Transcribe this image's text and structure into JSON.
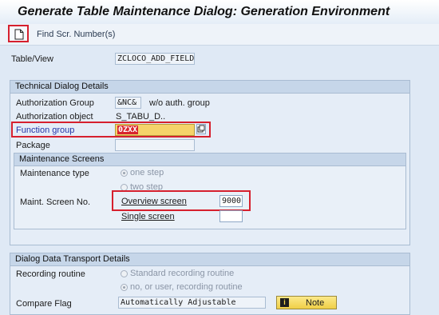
{
  "window": {
    "title": "Generate Table Maintenance Dialog: Generation Environment"
  },
  "toolbar": {
    "find_label": "Find Scr. Number(s)"
  },
  "table_view": {
    "label": "Table/View",
    "value": "ZCLOCO_ADD_FIELD"
  },
  "technical": {
    "header": "Technical Dialog Details",
    "auth_group_label": "Authorization Group",
    "auth_group_value": "&NC&",
    "auth_group_text": "w/o auth. group",
    "auth_object_label": "Authorization object",
    "auth_object_value": "S_TABU_D..",
    "function_group_label": "Function group",
    "function_group_value": "0ZXX",
    "package_label": "Package",
    "package_value": ""
  },
  "screens": {
    "header": "Maintenance Screens",
    "maint_type_label": "Maintenance type",
    "one_step_label": "one step",
    "two_step_label": "two step",
    "screen_no_label": "Maint. Screen No.",
    "overview_label": "Overview screen",
    "overview_value": "9000",
    "single_label": "Single screen",
    "single_value": ""
  },
  "transport": {
    "header": "Dialog Data Transport Details",
    "recording_label": "Recording routine",
    "standard_label": "Standard recording routine",
    "no_user_label": "no, or user, recording routine",
    "compare_label": "Compare Flag",
    "compare_value": "Automatically Adjustable",
    "note_label": "Note"
  }
}
